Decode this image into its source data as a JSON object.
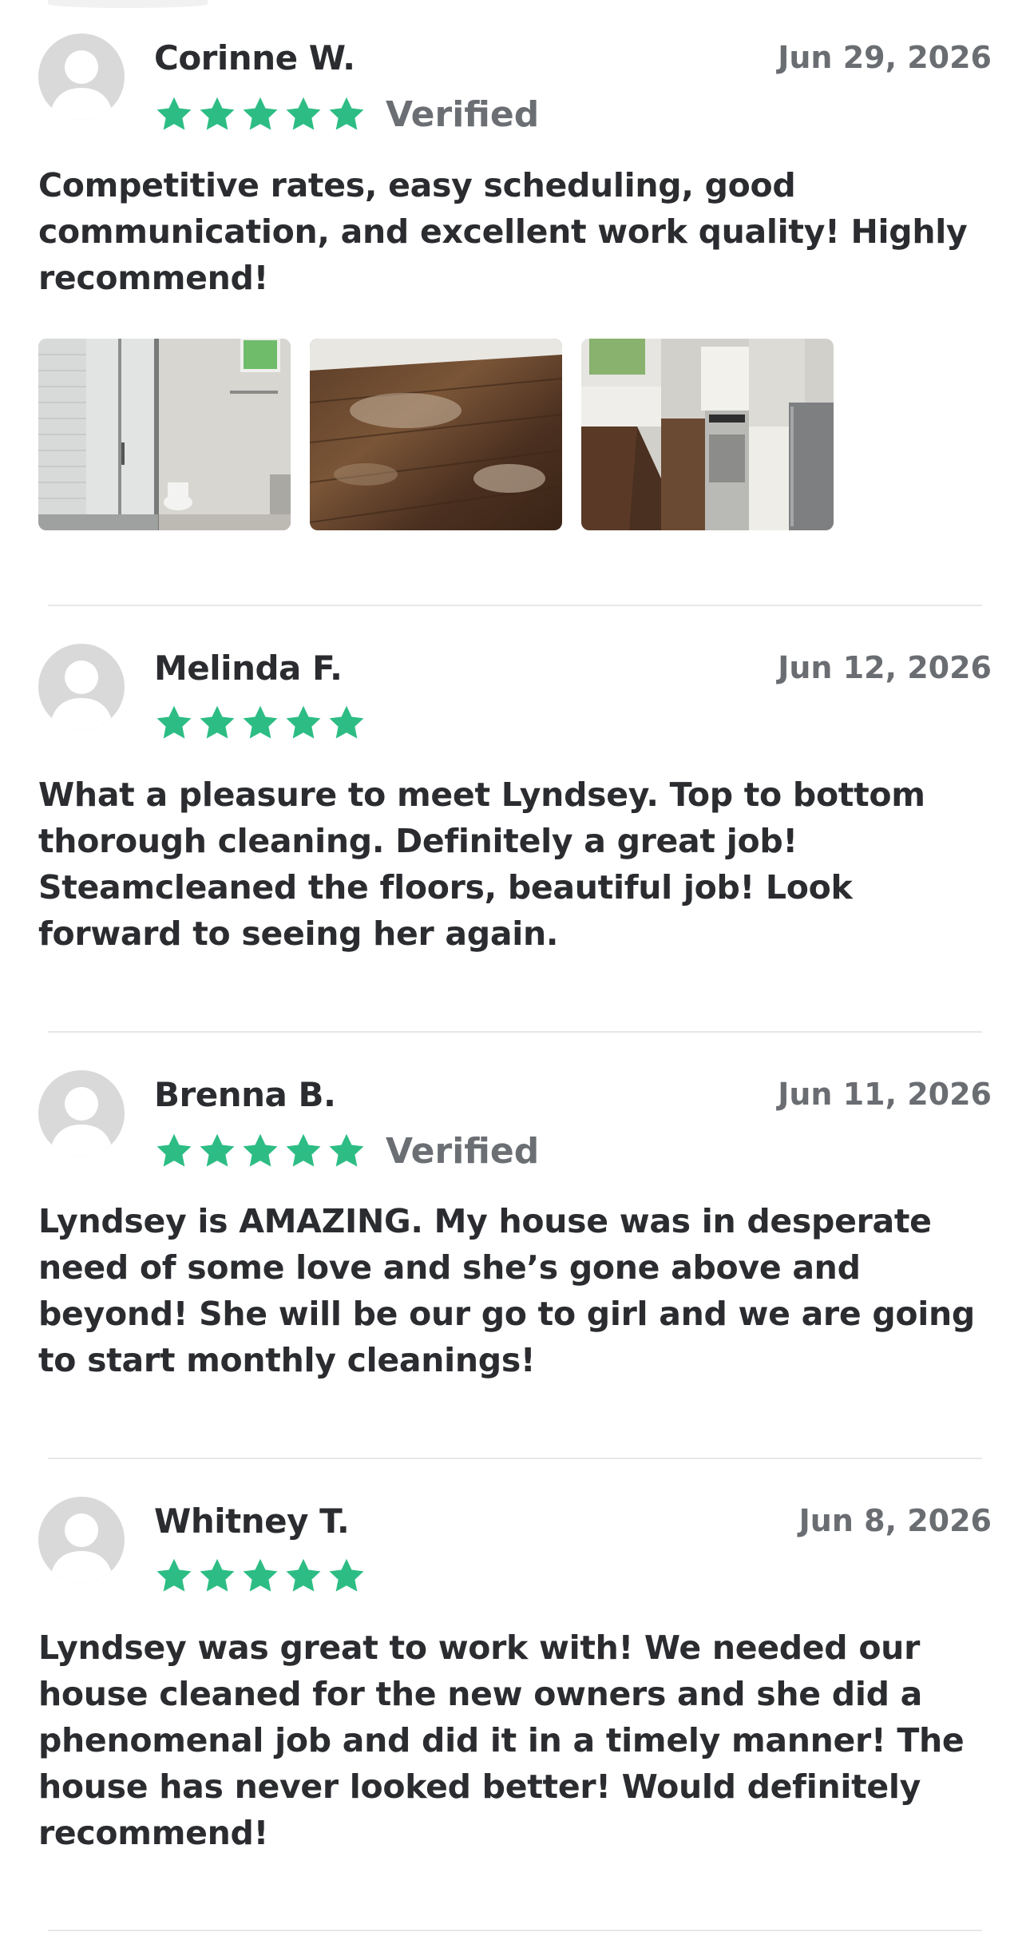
{
  "reviews": [
    {
      "name": "Corinne W.",
      "date": "Jun 29, 2026",
      "stars": 5,
      "verified": "Verified",
      "text": "Competitive rates, easy scheduling, good communication, and excellent work quality! Highly recommend!",
      "photos": [
        "bathroom-shower-photo",
        "hardwood-floor-photo",
        "kitchen-photo"
      ]
    },
    {
      "name": "Melinda F.",
      "date": "Jun 12, 2026",
      "stars": 5,
      "verified": "",
      "text": "What a pleasure to meet Lyndsey. Top to bottom thorough cleaning. Definitely a great job! Steamcleaned the floors, beautiful job! Look forward to seeing her again."
    },
    {
      "name": "Brenna B.",
      "date": "Jun 11, 2026",
      "stars": 5,
      "verified": "Verified",
      "text": "Lyndsey is AMAZING. My house was in desperate need of some love and she’s gone above and beyond! She will be our go to girl and we are going to start monthly cleanings!"
    },
    {
      "name": "Whitney T.",
      "date": "Jun 8, 2026",
      "stars": 5,
      "verified": "",
      "text": "Lyndsey was great to work with! We needed our house cleaned for the new owners and she did a phenomenal job and did it in a timely manner! The house has never looked better! Would definitely recommend!"
    }
  ],
  "colors": {
    "star": "#2dbd84",
    "avatar_bg": "#d9d9da",
    "avatar_fg": "#ffffff",
    "text": "#2b2c2f",
    "muted": "#6a6d72",
    "divider": "#e7e7e8"
  },
  "icons": {
    "avatar": "user-silhouette-icon",
    "star": "star-icon"
  }
}
